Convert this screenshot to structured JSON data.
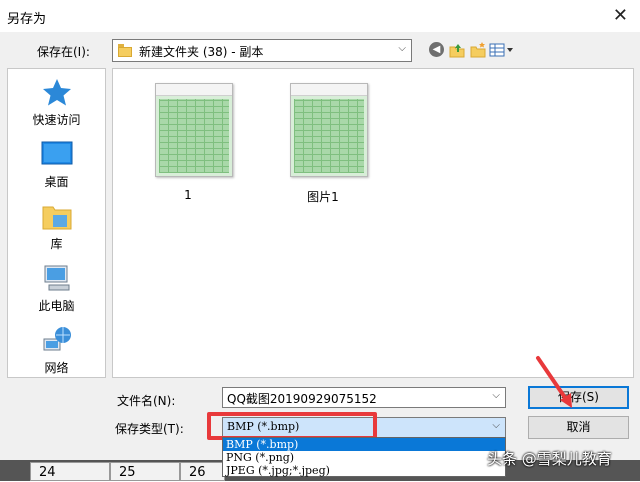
{
  "dialog": {
    "title": "另存为",
    "close_glyph": "✕",
    "save_in_label": "保存在(I):",
    "save_in_value": "新建文件夹 (38) - 副本",
    "places": [
      {
        "label": "快速访问",
        "icon": "star-icon"
      },
      {
        "label": "桌面",
        "icon": "desktop-icon"
      },
      {
        "label": "库",
        "icon": "library-folder-icon"
      },
      {
        "label": "此电脑",
        "icon": "computer-icon"
      },
      {
        "label": "网络",
        "icon": "network-icon"
      }
    ],
    "files": [
      {
        "name": "1",
        "icon": "spreadsheet-thumbnail"
      },
      {
        "name": "图片1",
        "icon": "spreadsheet-thumbnail"
      }
    ],
    "filename_label": "文件名(N):",
    "filename_value": "QQ截图20190929075152",
    "filetype_label": "保存类型(T):",
    "filetype_value": "BMP (*.bmp)",
    "filetype_options": [
      "BMP (*.bmp)",
      "PNG (*.png)",
      "JPEG (*.jpg;*.jpeg)"
    ],
    "selected_option_index": 0,
    "save_button": "保存(S)",
    "cancel_button": "取消",
    "arrow_glyph": "⌵"
  },
  "background": {
    "cells": [
      "24",
      "25",
      "26"
    ]
  },
  "watermark": "头条 @雪梨儿教育",
  "colors": {
    "selection": "#0a78d7",
    "highlight_box": "#e8393b",
    "dialog_bg": "#f0f0f0"
  }
}
